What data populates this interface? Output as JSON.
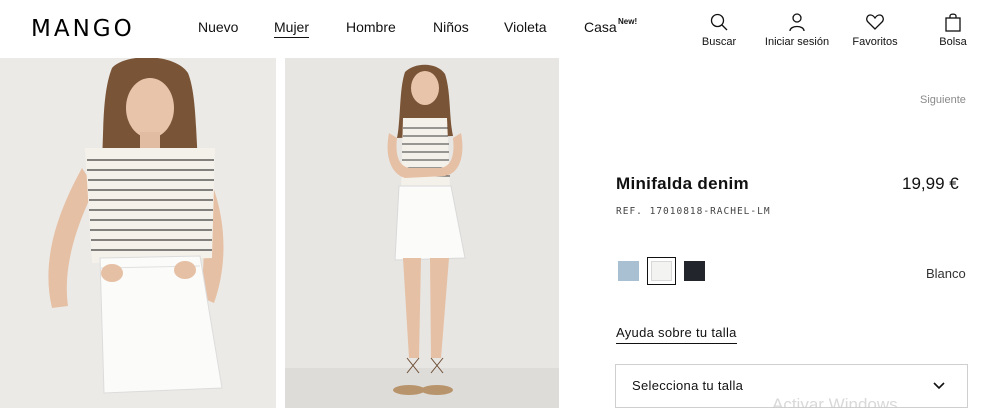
{
  "brand": {
    "logo": "MANGO"
  },
  "nav": {
    "items": [
      {
        "label": "Nuevo",
        "active": false
      },
      {
        "label": "Mujer",
        "active": true
      },
      {
        "label": "Hombre",
        "active": false
      },
      {
        "label": "Niños",
        "active": false
      },
      {
        "label": "Violeta",
        "active": false
      },
      {
        "label": "Casa",
        "active": false,
        "badge": "New!"
      }
    ]
  },
  "header_actions": {
    "search": {
      "label": "Buscar",
      "icon": "search-icon"
    },
    "login": {
      "label": "Iniciar sesión",
      "icon": "user-icon"
    },
    "favorites": {
      "label": "Favoritos",
      "icon": "heart-icon"
    },
    "bag": {
      "label": "Bolsa",
      "icon": "bag-icon"
    }
  },
  "product": {
    "next_label": "Siguiente",
    "title": "Minifalda denim",
    "price": "19,99 €",
    "ref": "REF. 17010818-RACHEL-LM",
    "colors": [
      {
        "name": "light-blue",
        "hex": "#a9bfd2",
        "selected": false
      },
      {
        "name": "white",
        "hex": "#f3f3f1",
        "selected": true
      },
      {
        "name": "black",
        "hex": "#23252d",
        "selected": false
      }
    ],
    "selected_color_name": "Blanco",
    "size_help_label": "Ayuda sobre tu talla",
    "size_select_placeholder": "Selecciona tu talla"
  },
  "overlay": {
    "watermark": "Activar Windows"
  }
}
